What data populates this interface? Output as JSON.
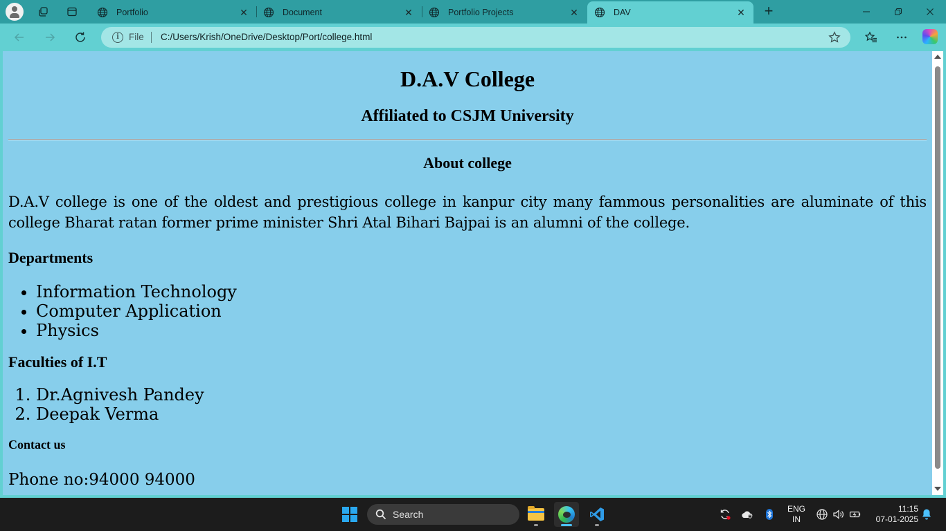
{
  "browser": {
    "tabs": [
      {
        "title": "Portfolio",
        "active": false
      },
      {
        "title": "Document",
        "active": false
      },
      {
        "title": "Portfolio Projects",
        "active": false
      },
      {
        "title": "DAV",
        "active": true
      }
    ],
    "address": {
      "scheme_label": "File",
      "url": "C:/Users/Krish/OneDrive/Desktop/Port/college.html"
    }
  },
  "page": {
    "title": "D.A.V College",
    "subtitle": "Affiliated to CSJM University",
    "about_heading": "About college",
    "about_text": "D.A.V college is one of the oldest and prestigious college in kanpur city many fammous personalities are aluminate of this college Bharat ratan former prime minister Shri Atal Bihari Bajpai is an alumni of the college.",
    "departments_heading": "Departments",
    "departments": [
      "Information Technology",
      "Computer Application",
      "Physics"
    ],
    "faculties_heading": "Faculties of I.T",
    "faculties": [
      "Dr.Agnivesh Pandey",
      "Deepak Verma"
    ],
    "contact_heading": "Contact us",
    "phone": "Phone no:94000 94000",
    "background_color": "#87ceeb"
  },
  "taskbar": {
    "search_label": "Search",
    "language_line1": "ENG",
    "language_line2": "IN",
    "time": "11:15",
    "date": "07-01-2025"
  },
  "colors": {
    "tabstrip": "#2f9ea2",
    "toolbar": "#62d0d2",
    "taskbar": "#1c1c1c"
  }
}
